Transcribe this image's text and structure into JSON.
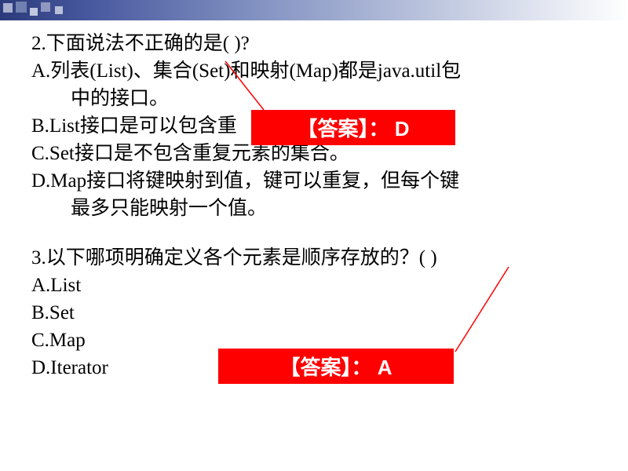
{
  "question2": {
    "text": "2.下面说法不正确的是(  )?",
    "optionA_line1": "A.列表(List)、集合(Set)和映射(Map)都是java.util包",
    "optionA_line2": "中的接口。",
    "optionB": "B.List接口是可以包含重",
    "optionC": "C.Set接口是不包含重复元素的集合。",
    "optionD_line1": "D.Map接口将键映射到值，键可以重复，但每个键",
    "optionD_line2": "最多只能映射一个值。"
  },
  "question3": {
    "text": "3.以下哪项明确定义各个元素是顺序存放的？(   )",
    "optionA": "A.List",
    "optionB": "B.Set",
    "optionC": "C.Map",
    "optionD": "D.Iterator"
  },
  "answer1": {
    "label": "【答案】： D"
  },
  "answer2": {
    "label": "【答案】： A"
  }
}
